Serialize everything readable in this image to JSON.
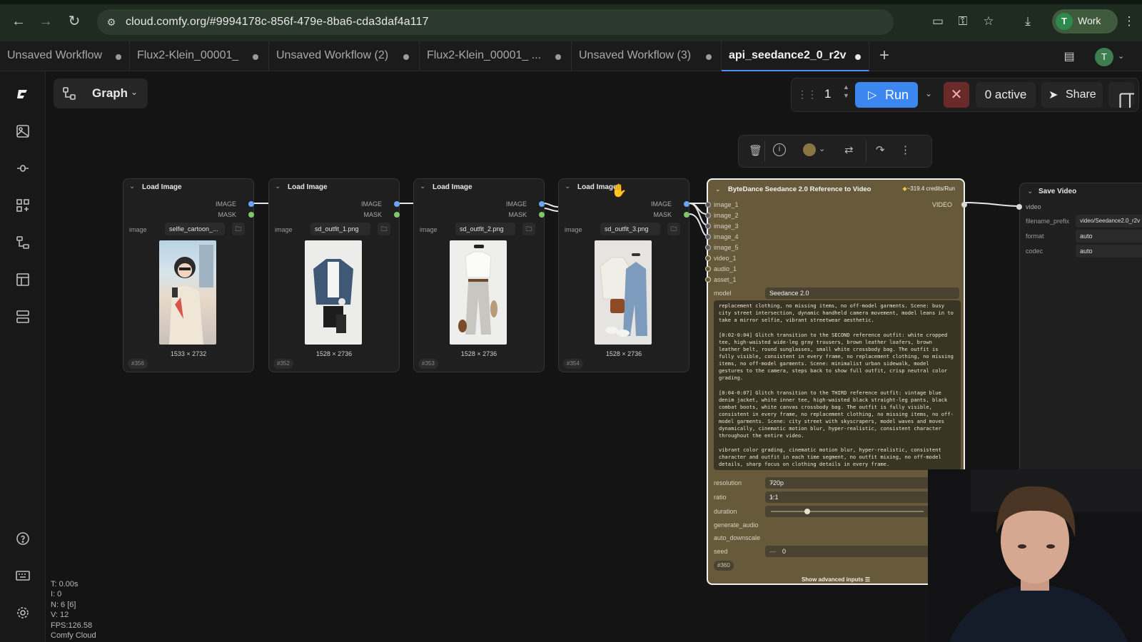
{
  "browser": {
    "url": "cloud.comfy.org/#9994178c-856f-479e-8ba6-cda3daf4a117",
    "profile_label": "Work",
    "profile_initial": "T"
  },
  "tabs": [
    {
      "label": "Unsaved Workflow"
    },
    {
      "label": "Flux2-Klein_00001_"
    },
    {
      "label": "Unsaved Workflow (2)"
    },
    {
      "label": "Flux2-Klein_00001_ ..."
    },
    {
      "label": "Unsaved Workflow (3)"
    },
    {
      "label": "api_seedance2_0_r2v",
      "active": true
    }
  ],
  "user_initial": "T",
  "toolbar": {
    "graph_label": "Graph",
    "queue_count": "1",
    "run_label": "Run",
    "active_label": "0 active",
    "share_label": "Share"
  },
  "colors": {
    "accent": "#3c86f0",
    "node_selected": "#665a3a",
    "image_pin": "#6aa4ff",
    "mask_pin": "#7ec86a"
  },
  "load_nodes": [
    {
      "title": "Load Image",
      "out_image": "IMAGE",
      "out_mask": "MASK",
      "widget_label": "image",
      "file": "selfie_cartoon_...",
      "dims": "1533 × 2732",
      "id": "#356"
    },
    {
      "title": "Load Image",
      "out_image": "IMAGE",
      "out_mask": "MASK",
      "widget_label": "image",
      "file": "sd_outfit_1.png",
      "dims": "1528 × 2736",
      "id": "#352"
    },
    {
      "title": "Load Image",
      "out_image": "IMAGE",
      "out_mask": "MASK",
      "widget_label": "image",
      "file": "sd_outfit_2.png",
      "dims": "1528 × 2736",
      "id": "#353"
    },
    {
      "title": "Load Image",
      "out_image": "IMAGE",
      "out_mask": "MASK",
      "widget_label": "image",
      "file": "sd_outfit_3.png",
      "dims": "1528 × 2736",
      "id": "#354"
    }
  ],
  "seedance": {
    "title": "ByteDance Seedance 2.0 Reference to Video",
    "credits": "~319.4 credits/Run",
    "output": "VIDEO",
    "inputs": [
      "image_1",
      "image_2",
      "image_3",
      "image_4",
      "image_5",
      "video_1",
      "audio_1",
      "asset_1"
    ],
    "model_label": "model",
    "model_value": "Seedance 2.0",
    "prompt": [
      "replacement clothing, no missing items, no off-model garments. Scene: busy city street intersection, dynamic handheld camera movement, model leans in to take a mirror selfie, vibrant streetwear aesthetic.",
      "[0:02-0:04] Glitch transition to the SECOND reference outfit: white cropped tee, high-waisted wide-leg gray trousers, brown leather loafers, brown leather belt, round sunglasses, small white crossbody bag. The outfit is fully visible, consistent in every frame, no replacement clothing, no missing items, no off-model garments. Scene: minimalist urban sidewalk, model gestures to the camera, steps back to show full outfit, crisp neutral color grading.",
      "[0:04-0:07] Glitch transition to the THIRD reference outfit: vintage blue denim jacket, white inner tee, high-waisted black straight-leg pants, black combat boots, white canvas crossbody bag. The outfit is fully visible, consistent in every frame, no replacement clothing, no missing items, no off-model garments. Scene: city street with skyscrapers, model waves and moves dynamically, cinematic motion blur, hyper-realistic, consistent character throughout the entire video.",
      "vibrant color grading, cinematic motion blur, hyper-realistic, consistent character and outfit in each time segment, no outfit mixing, no off-model details, sharp focus on clothing details in every frame."
    ],
    "resolution_label": "resolution",
    "resolution_value": "720p",
    "ratio_label": "ratio",
    "ratio_value": "1:1",
    "duration_label": "duration",
    "duration_value": "7",
    "duration_fraction": 0.24,
    "generate_audio_label": "generate_audio",
    "generate_audio": true,
    "auto_downscale_label": "auto_downscale",
    "auto_downscale": true,
    "seed_label": "seed",
    "seed_value": "0",
    "id": "#360",
    "advanced": "Show advanced inputs"
  },
  "save_node": {
    "title": "Save Video",
    "input": "video",
    "rows": [
      {
        "label": "filename_prefix",
        "value": "video/Seedance2.0_r2v"
      },
      {
        "label": "format",
        "value": "auto"
      },
      {
        "label": "codec",
        "value": "auto"
      }
    ]
  },
  "stats": [
    "T: 0.00s",
    "I: 0",
    "N: 6 [6]",
    "V: 12",
    "FPS:126.58",
    "Comfy Cloud"
  ]
}
